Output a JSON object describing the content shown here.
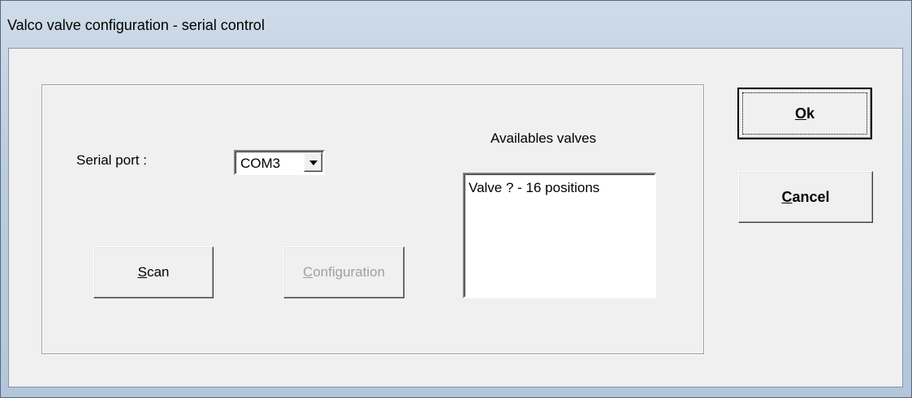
{
  "window": {
    "title": "Valco valve configuration - serial control"
  },
  "serial": {
    "label": "Serial port :",
    "selected_value": "COM3"
  },
  "available": {
    "label": "Availables valves",
    "items": [
      "Valve ? - 16 positions"
    ]
  },
  "buttons": {
    "scan_mnemonic": "S",
    "scan_rest": "can",
    "configuration_mnemonic": "C",
    "configuration_rest": "onfiguration",
    "ok_mnemonic": "O",
    "ok_rest": "k",
    "cancel_mnemonic": "C",
    "cancel_rest": "ancel"
  },
  "icons": {
    "combo_arrow": "chevron-down-icon"
  }
}
